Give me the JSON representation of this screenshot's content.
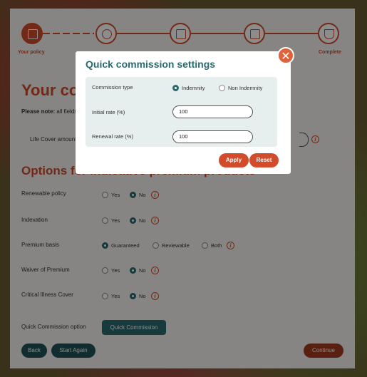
{
  "stepper": {
    "step1_label": "Your policy",
    "step5_label": "Complete"
  },
  "page": {
    "title": "Your co",
    "note_bold": "Please note:",
    "note_rest": " all fields",
    "life_cover_label": "Life Cover amount",
    "options_title": "Options for indicative premium products"
  },
  "options": [
    {
      "label": "Renewable policy",
      "choices": [
        "Yes",
        "No"
      ],
      "selected": "No"
    },
    {
      "label": "Indexation",
      "choices": [
        "Yes",
        "No"
      ],
      "selected": "No"
    },
    {
      "label": "Premium basis",
      "choices": [
        "Guaranteed",
        "Reviewable",
        "Both"
      ],
      "selected": "Guaranteed"
    },
    {
      "label": "Waiver of Premium",
      "choices": [
        "Yes",
        "No"
      ],
      "selected": "No"
    },
    {
      "label": "Critical Illness Cover",
      "choices": [
        "Yes",
        "No"
      ],
      "selected": "No"
    }
  ],
  "quick_commission": {
    "label": "Quick Commission option",
    "button": "Quick Commission"
  },
  "footer": {
    "back": "Back",
    "start_again": "Start Again",
    "continue": "Continue"
  },
  "modal": {
    "title": "Quick commission settings",
    "close": "✕",
    "commission_type_label": "Commission type",
    "commission_type_options": [
      "Indemnity",
      "Non Indemnity"
    ],
    "commission_type_selected": "Indemnity",
    "initial_rate_label": "Initial rate (%)",
    "initial_rate_value": "100",
    "renewal_rate_label": "Renewal rate (%)",
    "renewal_rate_value": "100",
    "apply": "Apply",
    "reset": "Reset"
  },
  "colors": {
    "accent": "#d24b2a",
    "teal": "#2a6a6f"
  }
}
